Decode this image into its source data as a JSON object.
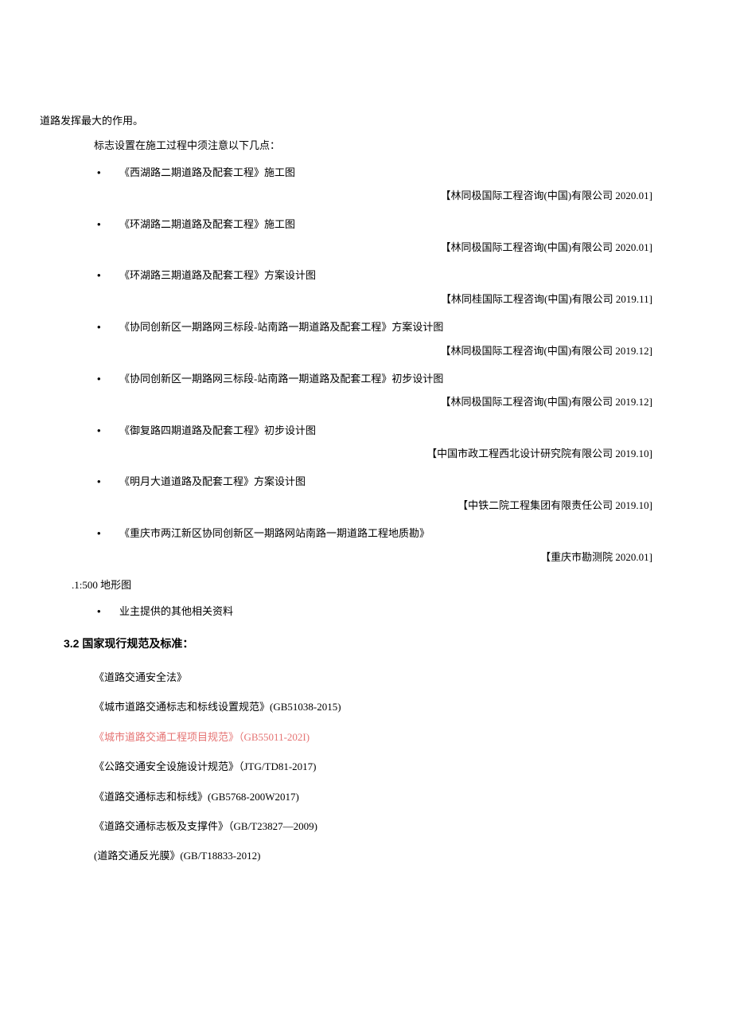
{
  "continuation": "道路发挥最大的作用。",
  "intro": "标志设置在施工过程中须注意以下几点：",
  "items": [
    {
      "text": "《西湖路二期道路及配套工程》施工图",
      "note": "【林同极国际工程咨询(中国)有限公司 2020.01]"
    },
    {
      "text": "《环湖路二期道路及配套工程》施工图",
      "note": "【林同极国际工程咨询(中国)有限公司 2020.01]"
    },
    {
      "text": "《环湖路三期道路及配套工程》方案设计图",
      "note": "【林同桂国际工程咨询(中国)有限公司 2019.11]"
    },
    {
      "text": "《协同创新区一期路网三标段-站南路一期道路及配套工程》方案设计图",
      "note": "【林同极国际工程咨询(中国)有限公司 2019.12]"
    },
    {
      "text": "《协同创新区一期路网三标段-站南路一期道路及配套工程》初步设计图",
      "note": "【林同极国际工程咨询(中国)有限公司 2019.12]"
    },
    {
      "text": "《御复路四期道路及配套工程》初步设计图",
      "note": "【中国市政工程西北设计研究院有限公司 2019.10]"
    },
    {
      "text": "《明月大道道路及配套工程》方案设计图",
      "note": "【中铁二院工程集团有限责任公司 2019.10]"
    },
    {
      "text": "《重庆市两江新区协同创新区一期路网站南路一期道路工程地质勘》",
      "note": "【重庆市勘测院 2020.01]"
    }
  ],
  "plain_line": ".1:500 地形图",
  "last_bullet": "业主提供的其他相关资料",
  "section_heading": "3.2 国家现行规范及标准：",
  "standards": [
    {
      "text": "《道路交通安全法》",
      "highlight": false
    },
    {
      "text": "《城市道路交通标志和标线设置规范》(GB51038-2015)",
      "highlight": false
    },
    {
      "text": "《城市道路交通工程项目规范》（GB55011-202I)",
      "highlight": true
    },
    {
      "text": "《公路交通安全设施设计规范》（JTG/TD81-2017)",
      "highlight": false
    },
    {
      "text": "《道路交通标志和标线》(GB5768-200W2017)",
      "highlight": false
    },
    {
      "text": "《道路交通标志板及支撑件》（GB/T23827—2009)",
      "highlight": false
    },
    {
      "text": "(道路交通反光膜》(GB/T18833-2012)",
      "highlight": false
    }
  ]
}
